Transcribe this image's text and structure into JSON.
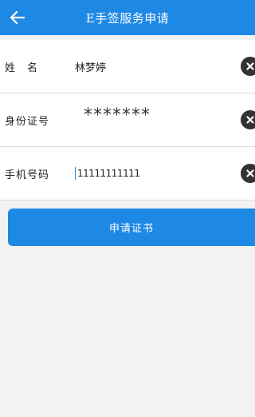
{
  "header": {
    "title": "E手签服务申请",
    "back_icon": "arrow-left-icon"
  },
  "form": {
    "name": {
      "label": "姓　名",
      "value": "林梦婷"
    },
    "id_number": {
      "label": "身份证号",
      "value": "*******"
    },
    "phone": {
      "label": "手机号码",
      "value": "11111111111"
    },
    "clear_icon": "clear-x-icon"
  },
  "submit_label": "申请证书",
  "colors": {
    "primary": "#1e88e5",
    "background": "#f2f2f2"
  }
}
